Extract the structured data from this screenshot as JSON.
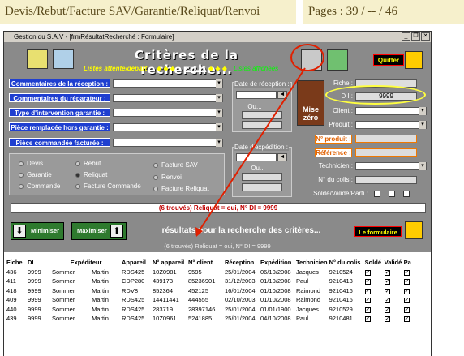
{
  "header": {
    "path": "Devis/Rebut/Facture SAV/Garantie/Reliquat/Renvoi",
    "pages": "Pages : 39 / -- / 46"
  },
  "window": {
    "title": "Gestion du S.A.V - [frmRésultatRecherché : Formulaire]"
  },
  "banner": {
    "title": "Critères de la recherche...",
    "status": "Listes attente/départ",
    "choix": "CHOIX",
    "liste": "Listes affichées"
  },
  "quit_label": "Quitter",
  "reset_label": "Mise zéro",
  "fields": {
    "commentaires_reception": "Commentaires de la réception :",
    "commentaires_reparateur": "Commentaires du réparateur :",
    "type_intervention": "Type d'intervention garantie :",
    "piece_remplacee": "Pièce remplacée hors garantie :",
    "piece_commandee": "Pièce commandée facturée :"
  },
  "dates": {
    "reception": "Date de réception :",
    "ou1": "Ou...",
    "expedition": "Date d'expédition :",
    "ou2": "Ou..."
  },
  "right": {
    "fiche": "Fiche :",
    "di": "D I :",
    "di_value": "9999",
    "client": "Client :",
    "produit": "Produit :",
    "no_produit": "N° produit :",
    "reference": "Référence :",
    "technicien": "Technicien :",
    "no_colis": "N° du colis :",
    "solde": "Soldé/Validé/Partí :"
  },
  "radios": [
    "Devis",
    "Rebut",
    "Facture SAV",
    "Garantie",
    "Reliquat",
    "Renvoi",
    "Commande",
    "Facture Commande",
    "Facture Reliquat"
  ],
  "found_line": "(6 trouvés)   Reliquat = oui, N° DI = 9999",
  "minimize_label": "Minimiser",
  "maximize_label": "Maximiser",
  "results_title": "résultats pour la recherche des critères...",
  "form_label": "Le formulaire",
  "found_line2": "(6 trouvés)   Reliquat = oui, N° DI = 9999",
  "columns": [
    "Fiche",
    "DI",
    "Expéditeur",
    "Appareil",
    "N° appareil",
    "N° client",
    "Réception",
    "Expédition",
    "Technicien",
    "N° du colis",
    "Soldé",
    "Validé",
    "Pa"
  ],
  "rows": [
    [
      "436",
      "9999",
      "Sommer",
      "Martin",
      "RDS425",
      "10Z0981",
      "9595",
      "25/01/2004",
      "06/10/2008",
      "Jacques",
      "9210524"
    ],
    [
      "411",
      "9999",
      "Sommer",
      "Martin",
      "CDP280",
      "439173",
      "85236901",
      "31/12/2003",
      "01/10/2008",
      "Paul",
      "9210413"
    ],
    [
      "418",
      "9999",
      "Sommer",
      "Martin",
      "RDV8",
      "852364",
      "452125",
      "16/01/2004",
      "01/10/2008",
      "Raimond",
      "9210416"
    ],
    [
      "409",
      "9999",
      "Sommer",
      "Martin",
      "RDS425",
      "14411441",
      "444555",
      "02/10/2003",
      "01/10/2008",
      "Raimond",
      "9210416"
    ],
    [
      "440",
      "9999",
      "Sommer",
      "Martin",
      "RDS425",
      "283719",
      "28397146",
      "25/01/2004",
      "01/01/1900",
      "Jacques",
      "9210529"
    ],
    [
      "439",
      "9999",
      "Sommer",
      "Martin",
      "RDS425",
      "10Z0961",
      "5241885",
      "25/01/2004",
      "04/10/2008",
      "Paul",
      "9210481"
    ]
  ]
}
